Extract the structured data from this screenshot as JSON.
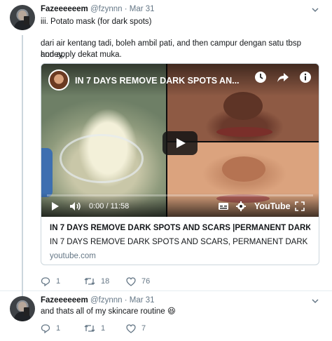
{
  "tweets": [
    {
      "display_name": "Fazeeeeeem",
      "meta": "@fzynnn · Mar 31",
      "lines": [
        "iii. Potato mask (for dark spots)",
        "dari air kentang tadi, boleh ambil pati, and then campur dengan satu tbsp honey,",
        "and apply dekat muka."
      ],
      "card": {
        "video_title_overlay": "IN 7 DAYS REMOVE DARK SPOTS AN...",
        "time": "0:00 / 11:58",
        "progress": 0,
        "yt_label": "YouTube",
        "title": "IN 7 DAYS REMOVE DARK SPOTS AND SCARS |PERMANENT DARK...",
        "description": "IN 7 DAYS REMOVE DARK SPOTS AND SCARS, PERMANENT DARK ...",
        "domain": "youtube.com"
      },
      "counts": {
        "reply": "1",
        "retweet": "18",
        "like": "76"
      }
    },
    {
      "display_name": "Fazeeeeeem",
      "meta": "@fzynnn · Mar 31",
      "text": "and thats all of my skincare routine 😆",
      "counts": {
        "reply": "1",
        "retweet": "1",
        "like": "7"
      }
    }
  ],
  "colors": {
    "muted": "#657786",
    "border": "#ccd6dd",
    "progress": "#ff0000"
  },
  "icons": [
    "caret-down-icon",
    "clock-icon",
    "share-icon",
    "info-icon",
    "play-icon",
    "volume-icon",
    "captions-icon",
    "gear-icon",
    "fullscreen-icon",
    "reply-icon",
    "retweet-icon",
    "like-icon"
  ]
}
